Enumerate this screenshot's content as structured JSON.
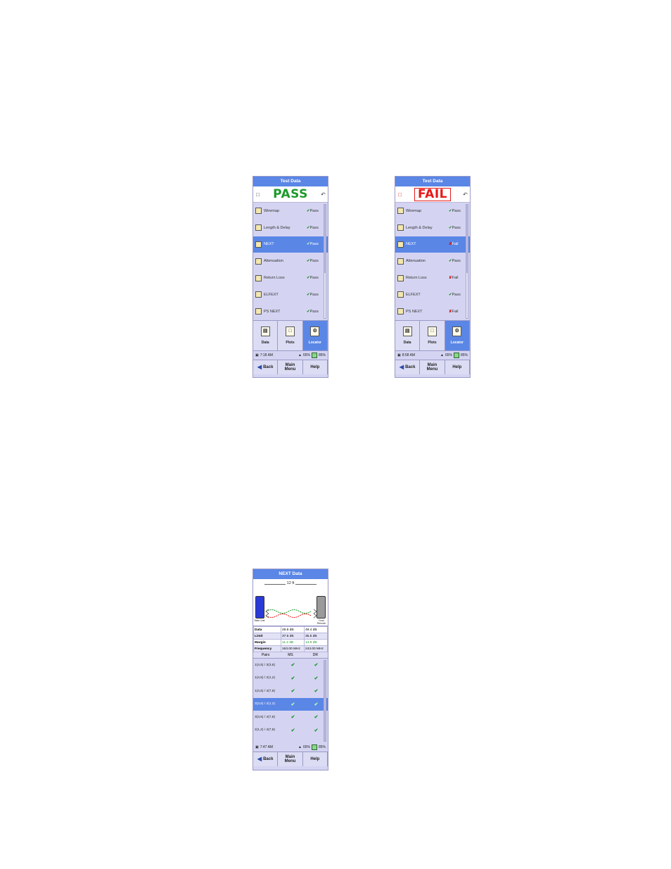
{
  "device_pass": {
    "title": "Test Data",
    "result": "PASS",
    "items": [
      {
        "label": "Wiremap",
        "status": "Pass",
        "ok": true
      },
      {
        "label": "Length & Delay",
        "status": "Pass",
        "ok": true
      },
      {
        "label": "NEXT",
        "status": "Pass",
        "ok": true
      },
      {
        "label": "Attenuation",
        "status": "Pass",
        "ok": true
      },
      {
        "label": "Return Loss",
        "status": "Pass",
        "ok": true
      },
      {
        "label": "ELFEXT",
        "status": "Pass",
        "ok": true
      },
      {
        "label": "PS NEXT",
        "status": "Pass",
        "ok": true
      }
    ],
    "buttons": [
      "Data",
      "Plots",
      "Locator"
    ],
    "time": "7:18 AM",
    "wifi": "65%",
    "battery": "85%",
    "nav": {
      "back": "Back",
      "main1": "Main",
      "main2": "Menu",
      "help": "Help"
    }
  },
  "device_fail": {
    "title": "Test Data",
    "result": "FAIL",
    "items": [
      {
        "label": "Wiremap",
        "status": "Pass",
        "ok": true
      },
      {
        "label": "Length & Delay",
        "status": "Pass",
        "ok": true
      },
      {
        "label": "NEXT",
        "status": "Fail",
        "ok": false
      },
      {
        "label": "Attenuation",
        "status": "Pass",
        "ok": true
      },
      {
        "label": "Return Loss",
        "status": "Fail",
        "ok": false
      },
      {
        "label": "ELFEXT",
        "status": "Pass",
        "ok": true
      },
      {
        "label": "PS NEXT",
        "status": "Fail",
        "ok": false
      }
    ],
    "buttons": [
      "Data",
      "Plots",
      "Locator"
    ],
    "time": "8:58 AM",
    "wifi": "65%",
    "battery": "85%",
    "nav": {
      "back": "Back",
      "main1": "Main",
      "main2": "Menu",
      "help": "Help"
    }
  },
  "device_next": {
    "title": "NEXT Data",
    "distance": "12 ft",
    "left_unit": "Main Unit",
    "right_unit": "Dual Remote",
    "measurements": [
      {
        "label": "Data",
        "a": "48.8 dB",
        "b": "49.4 dB"
      },
      {
        "label": "Limit",
        "a": "37.6 dB",
        "b": "35.5 dB"
      },
      {
        "label": "Margin",
        "a": "11.2 dB",
        "b": "13.9 dB"
      },
      {
        "label": "Frequency",
        "a": "163.00 MHz",
        "b": "243.00 MHz"
      }
    ],
    "pairs_header": [
      "Pairs",
      "MS",
      "DR"
    ],
    "pairs": [
      "1(4,5) / 3(3,6)",
      "1(4,5) / 2(1,2)",
      "1(4,5) / 4(7,8)",
      "3(3,6) / 2(1,2)",
      "3(3,6) / 4(7,8)",
      "2(1,2) / 4(7,8)"
    ],
    "time": "7:47 AM",
    "wifi": "65%",
    "battery": "85%",
    "nav": {
      "back": "Back",
      "main1": "Main",
      "main2": "Menu",
      "help": "Help"
    }
  },
  "colors": {
    "pass": "#1c9a2c",
    "fail": "#e81818",
    "accent": "#5a86e6",
    "panel": "#d4d4f2"
  }
}
